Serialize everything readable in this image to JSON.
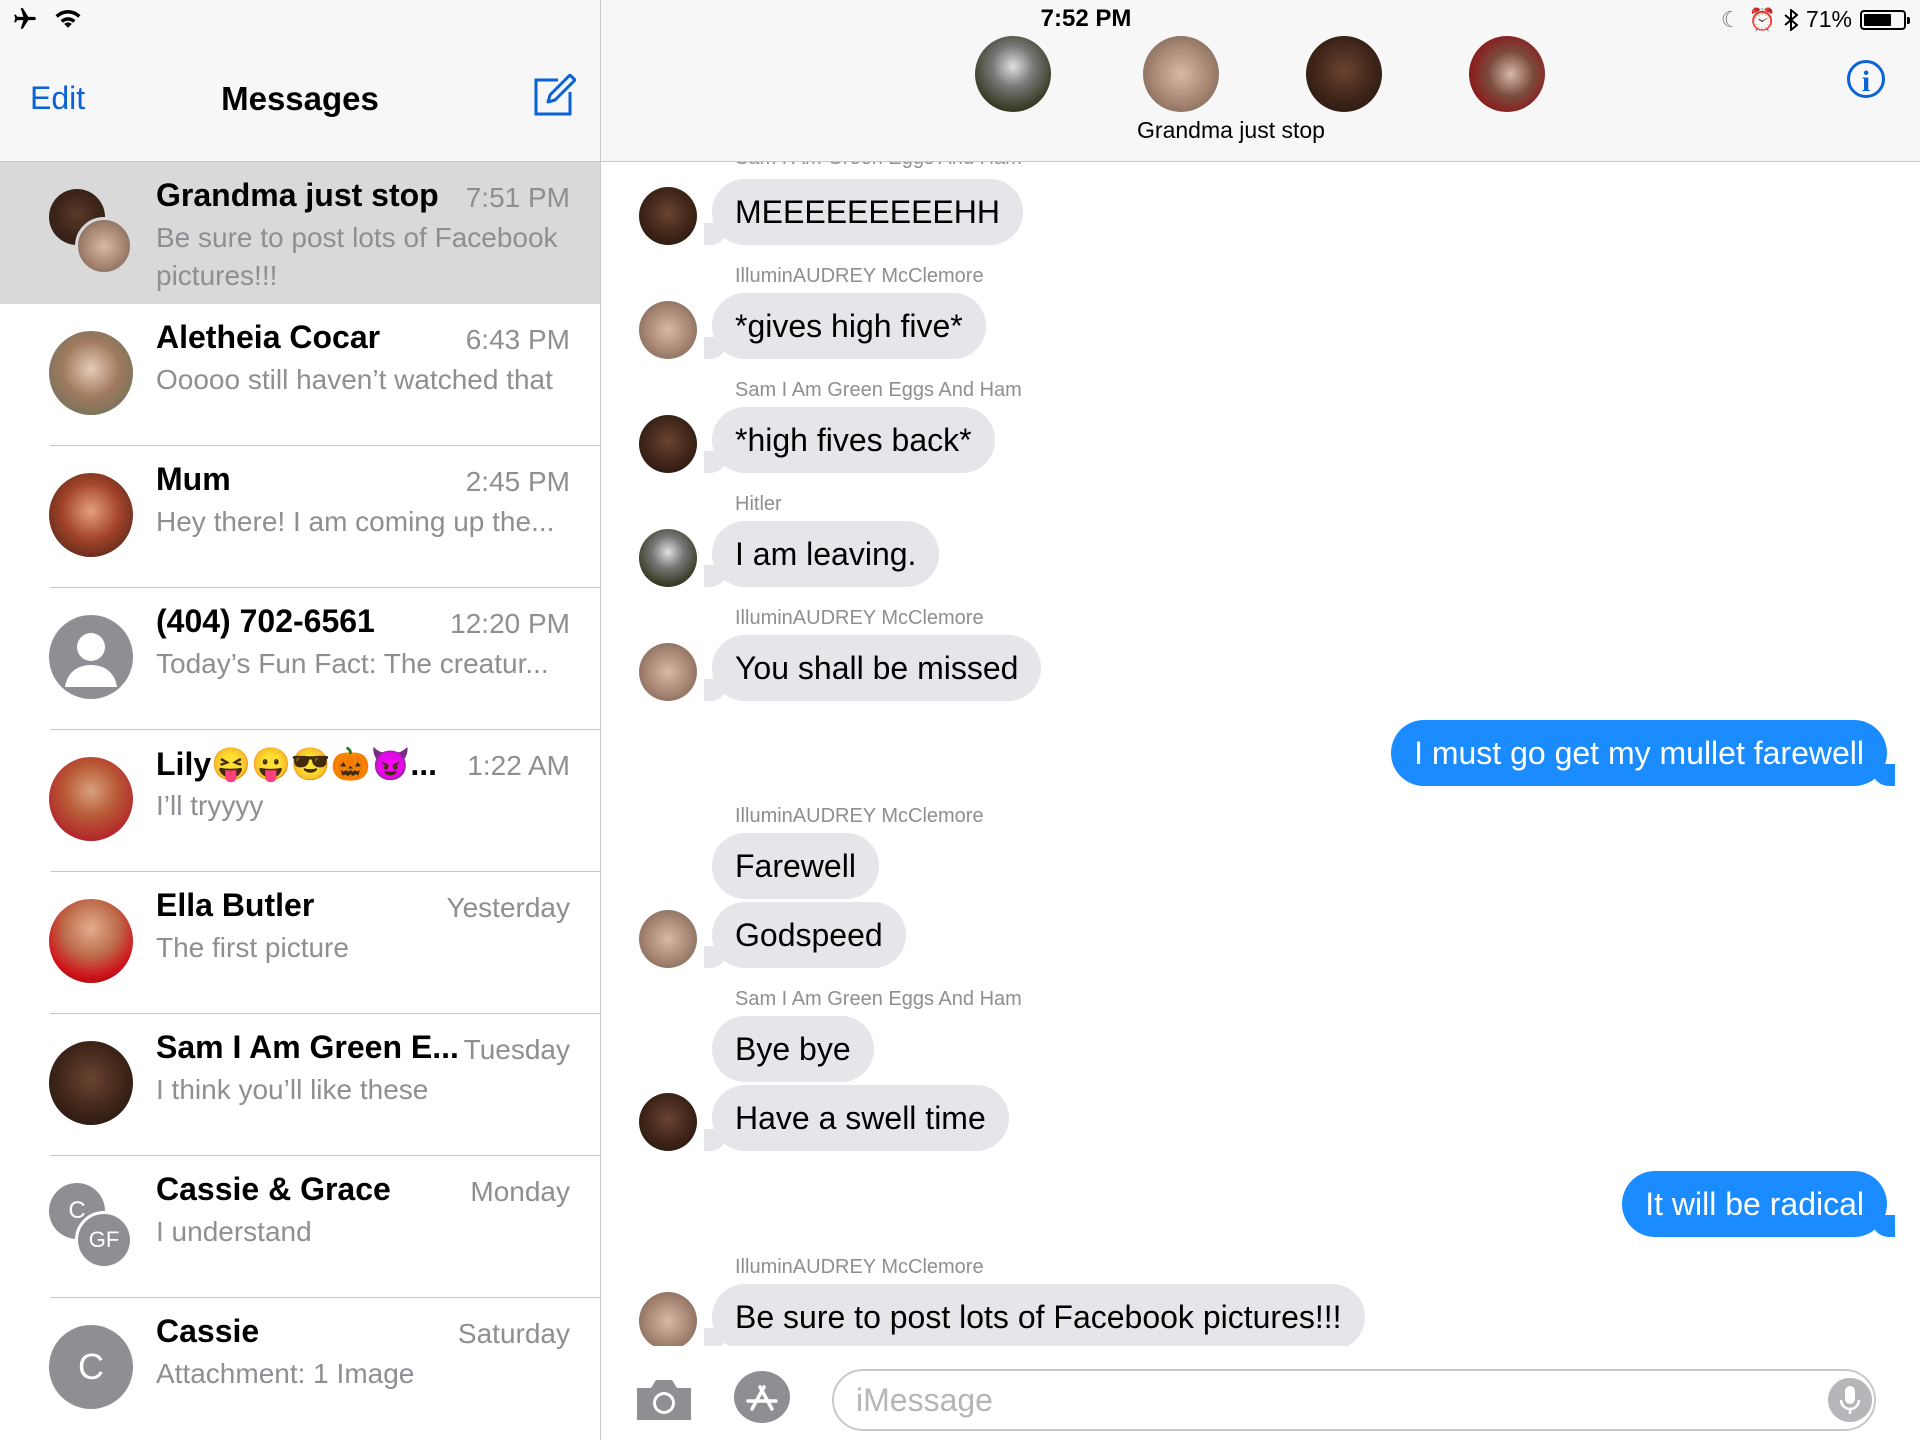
{
  "status": {
    "time": "7:52 PM",
    "battery": "71%",
    "battery_level": 0.71,
    "icons_left": [
      "airplane-icon",
      "wifi-icon"
    ],
    "icons_right": [
      "moon-icon",
      "alarm-icon",
      "bluetooth-icon"
    ]
  },
  "sidebar": {
    "edit_label": "Edit",
    "title": "Messages",
    "conversations": [
      {
        "name": "Grandma just stop",
        "time": "7:51 PM",
        "preview": "Be sure to post lots of Facebook pictures!!!"
      },
      {
        "name": "Aletheia Cocar",
        "time": "6:43 PM",
        "preview": "Ooooo still haven’t watched that"
      },
      {
        "name": "Mum",
        "time": "2:45 PM",
        "preview": "Hey there! I am coming up the..."
      },
      {
        "name": "(404) 702-6561",
        "time": "12:20 PM",
        "preview": "Today’s Fun Fact: The creatur..."
      },
      {
        "name": "Lily😝😛😎🎃😈...",
        "time": "1:22 AM",
        "preview": "I’ll tryyyy"
      },
      {
        "name": "Ella Butler",
        "time": "Yesterday",
        "preview": "The first picture"
      },
      {
        "name": "Sam I Am Green E...",
        "time": "Tuesday",
        "preview": "I think you’ll like these"
      },
      {
        "name": "Cassie & Grace",
        "time": "Monday",
        "preview": "I understand",
        "initials": [
          "C",
          "GF"
        ]
      },
      {
        "name": "Cassie",
        "time": "Saturday",
        "preview": "Attachment: 1 Image",
        "initials": [
          "C"
        ]
      }
    ]
  },
  "chat": {
    "group_name": "Grandma just stop",
    "partial_sender": "Sam I Am Green Eggs And Ham",
    "messages": [
      {
        "sender": "",
        "text": "MEEEEEEEEEHH"
      },
      {
        "sender": "IlluminAUDREY McClemore",
        "text": "*gives high five*"
      },
      {
        "sender": "Sam I Am Green Eggs And Ham",
        "text": "*high fives back*"
      },
      {
        "sender": "Hitler",
        "text": "I am leaving."
      },
      {
        "sender": "IlluminAUDREY McClemore",
        "text": "You shall be missed"
      },
      {
        "sender": "",
        "text": "I must go get my mullet farewell"
      },
      {
        "sender": "IlluminAUDREY McClemore",
        "text": "Farewell"
      },
      {
        "sender": "",
        "text": "Godspeed"
      },
      {
        "sender": "Sam I Am Green Eggs And Ham",
        "text": "Bye bye"
      },
      {
        "sender": "",
        "text": "Have a swell time"
      },
      {
        "sender": "",
        "text": "It will be radical"
      },
      {
        "sender": "IlluminAUDREY McClemore",
        "text": "Be sure to post lots of Facebook pictures!!!"
      }
    ]
  },
  "input": {
    "placeholder": "iMessage"
  },
  "colors": {
    "accent": "#0a63d6",
    "outgoing_bubble": "#1a8cff",
    "incoming_bubble": "#e5e5ea",
    "selected_row": "#d9d9d9",
    "secondary_text": "#8e8e93"
  }
}
